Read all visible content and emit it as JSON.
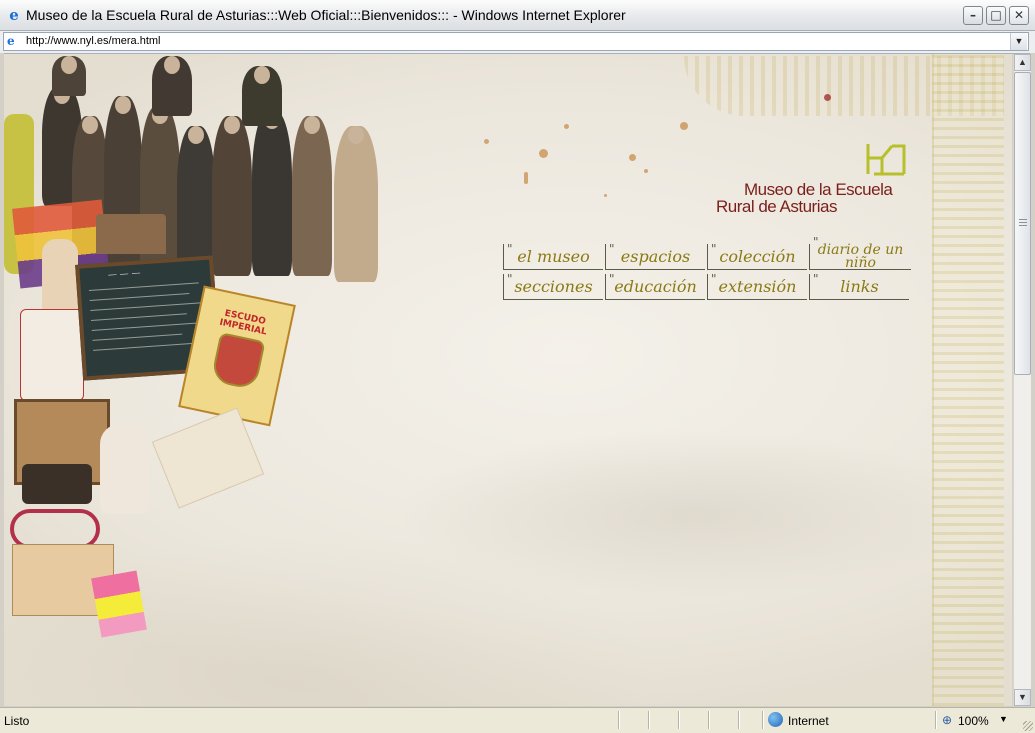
{
  "window": {
    "title": "Museo de la Escuela Rural de Asturias:::Web Oficial:::Bienvenidos::: - Windows Internet Explorer",
    "minimize_glyph": "–",
    "maximize_glyph": "□",
    "close_glyph": "✕"
  },
  "address_bar": {
    "url": "http://www.nyl.es/mera.html"
  },
  "page": {
    "logo": {
      "line1": "Museo de la Escuela",
      "line2": "Rural de Asturias",
      "accent_color": "#7a1f1a"
    },
    "nav": [
      {
        "label": "el museo"
      },
      {
        "label": "espacios"
      },
      {
        "label": "colección"
      },
      {
        "label": "diario de un niño"
      },
      {
        "label": "secciones"
      },
      {
        "label": "educación"
      },
      {
        "label": "extensión"
      },
      {
        "label": "links"
      }
    ],
    "collage": {
      "book_title": "ESCUDO IMPERIAL"
    }
  },
  "status_bar": {
    "status": "Listo",
    "zone": "Internet",
    "zoom": "100%"
  }
}
